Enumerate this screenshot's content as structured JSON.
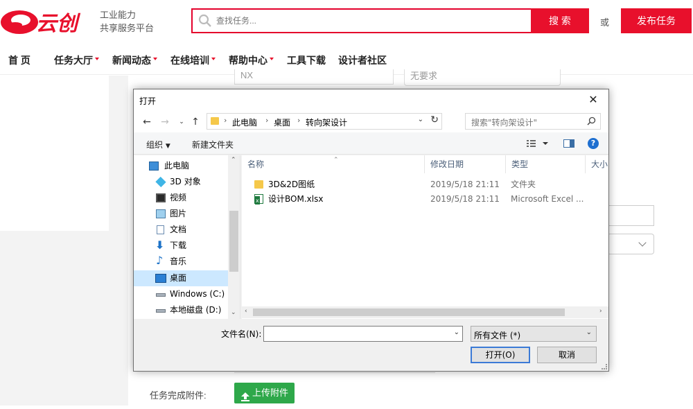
{
  "site": {
    "logo_text": "云创",
    "slogan_line1": "工业能力",
    "slogan_line2": "共享服务平台",
    "search_placeholder": "查找任务...",
    "search_button": "搜 索",
    "or_text": "或",
    "publish_button": "发布任务",
    "brand_color": "#e8102c"
  },
  "nav": [
    {
      "label": "首 页",
      "dropdown": false
    },
    {
      "label": "任务大厅",
      "dropdown": true
    },
    {
      "label": "新闻动态",
      "dropdown": true
    },
    {
      "label": "在线培训",
      "dropdown": true
    },
    {
      "label": "帮助中心",
      "dropdown": true
    },
    {
      "label": "工具下载",
      "dropdown": false
    },
    {
      "label": "设计者社区",
      "dropdown": false
    }
  ],
  "form_background": {
    "software_value": "NX",
    "requirement_value": "无要求",
    "attachment_label": "任务完成附件:",
    "upload_button": "上传附件",
    "upload_color": "#2ea84a"
  },
  "dialog": {
    "title": "打开",
    "close_icon": "close-icon",
    "breadcrumb": [
      "此电脑",
      "桌面",
      "转向架设计"
    ],
    "search_placeholder": "搜索\"转向架设计\"",
    "toolbar": {
      "organize": "组织",
      "new_folder": "新建文件夹"
    },
    "nav_tree": [
      {
        "label": "此电脑",
        "icon": "computer-icon",
        "selected": false
      },
      {
        "label": "3D 对象",
        "icon": "3d-objects-icon",
        "selected": false
      },
      {
        "label": "视频",
        "icon": "video-icon",
        "selected": false
      },
      {
        "label": "图片",
        "icon": "pictures-icon",
        "selected": false
      },
      {
        "label": "文档",
        "icon": "documents-icon",
        "selected": false
      },
      {
        "label": "下载",
        "icon": "download-icon",
        "selected": false
      },
      {
        "label": "音乐",
        "icon": "music-icon",
        "selected": false
      },
      {
        "label": "桌面",
        "icon": "desktop-icon",
        "selected": true
      },
      {
        "label": "Windows (C:)",
        "icon": "drive-icon",
        "selected": false
      },
      {
        "label": "本地磁盘 (D:)",
        "icon": "drive-icon",
        "selected": false
      }
    ],
    "columns": {
      "name": "名称",
      "date": "修改日期",
      "type": "类型",
      "size": "大小"
    },
    "files": [
      {
        "name": "3D&2D图纸",
        "date": "2019/5/18 21:11",
        "type": "文件夹",
        "icon": "folder-icon"
      },
      {
        "name": "设计BOM.xlsx",
        "date": "2019/5/18 21:11",
        "type": "Microsoft Excel ...",
        "icon": "excel-file-icon"
      }
    ],
    "filename_label": "文件名(N):",
    "filename_value": "",
    "filetype_value": "所有文件 (*)",
    "open_button": "打开(O)",
    "cancel_button": "取消"
  }
}
